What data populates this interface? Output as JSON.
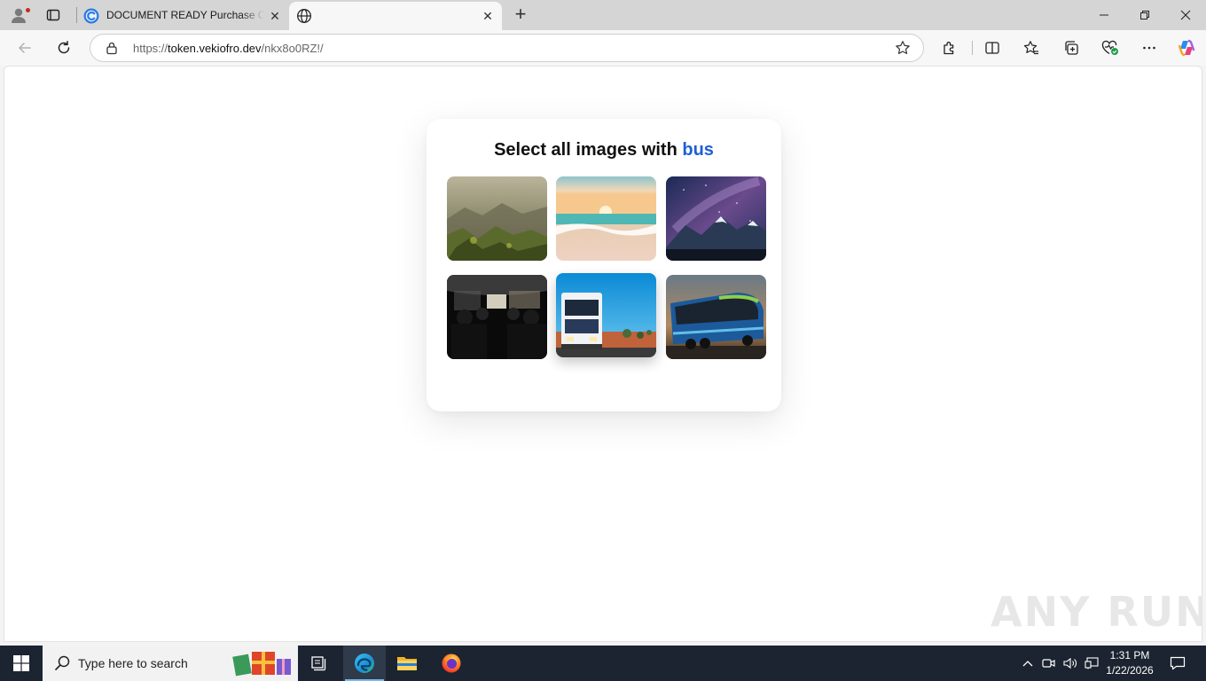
{
  "browser": {
    "tabs": [
      {
        "title": "DOCUMENT READY Purchase Order",
        "favicon": "captcha-c-icon",
        "active": false
      },
      {
        "title": "",
        "favicon": "globe-icon",
        "active": true
      }
    ],
    "address": {
      "scheme": "https://",
      "host": "token.vekiofro.dev",
      "path": "/nkx8o0RZ!/"
    },
    "window_controls": [
      "minimize",
      "restore",
      "close"
    ],
    "toolbar_icons": [
      "extensions-icon",
      "split-screen-icon",
      "favorites-icon",
      "collections-icon",
      "browser-essentials-icon",
      "more-icon",
      "copilot-icon"
    ]
  },
  "captcha": {
    "prompt_prefix": "Select all images with",
    "keyword": "bus",
    "keyword_color": "#1e5fd6",
    "tiles": [
      {
        "subject": "misty mountain valley",
        "selected": false
      },
      {
        "subject": "beach at sunset",
        "selected": false
      },
      {
        "subject": "night sky over mountains",
        "selected": false
      },
      {
        "subject": "bus interior with passengers",
        "selected": false
      },
      {
        "subject": "truck on highway",
        "selected": false
      },
      {
        "subject": "double-decker coach bus",
        "selected": false
      }
    ]
  },
  "watermark": {
    "text": "ANY RUN"
  },
  "taskbar": {
    "search_placeholder": "Type here to search",
    "time": "1:31 PM",
    "date": "1/22/2026",
    "apps": [
      "task-view-icon",
      "edge-icon",
      "file-explorer-icon",
      "firefox-icon"
    ]
  }
}
